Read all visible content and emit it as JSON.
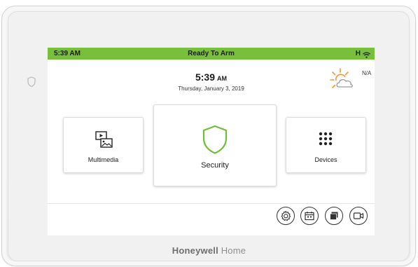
{
  "status_bar": {
    "time": "5:39 AM",
    "title": "Ready To Arm",
    "indicator": "H",
    "wifi_icon": "wifi-icon",
    "color": "#78bf3c"
  },
  "clock": {
    "time": "5:39",
    "ampm": "AM",
    "date": "Thursday, January 3, 2019"
  },
  "weather": {
    "icon": "partly-cloudy-sun-icon",
    "value": "N/A"
  },
  "tiles": {
    "multimedia": {
      "label": "Multimedia",
      "icon": "multimedia-icon"
    },
    "security": {
      "label": "Security",
      "icon": "shield-icon",
      "accent": "#6cbf3a"
    },
    "devices": {
      "label": "Devices",
      "icon": "keypad-grid-icon"
    }
  },
  "bottom_buttons": [
    {
      "icon": "settings-icon"
    },
    {
      "icon": "calendar-icon"
    },
    {
      "icon": "messages-icon"
    },
    {
      "icon": "camera-icon"
    }
  ],
  "brand": {
    "bold": "Honeywell",
    "light": "Home"
  }
}
